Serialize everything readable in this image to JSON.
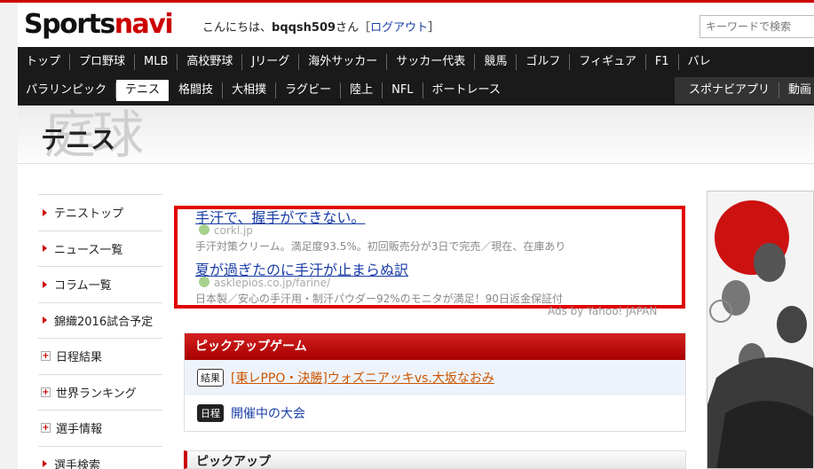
{
  "header": {
    "logo_part1": "Sports",
    "logo_part2": "navi",
    "greeting_prefix": "こんにちは、",
    "username": "bqqsh509",
    "greeting_suffix": "さん［",
    "logout": "ログアウト",
    "bracket_close": "］",
    "search_placeholder": "キーワードで検索"
  },
  "nav": {
    "row1": [
      "トップ",
      "プロ野球",
      "MLB",
      "高校野球",
      "Jリーグ",
      "海外サッカー",
      "サッカー代表",
      "競馬",
      "ゴルフ",
      "フィギュア",
      "F1",
      "バレ"
    ],
    "row2": [
      "パラリンピック",
      "テニス",
      "格闘技",
      "大相撲",
      "ラグビー",
      "陸上",
      "NFL",
      "ボートレース"
    ],
    "row2_right": [
      "スポナビアプリ",
      "動画"
    ]
  },
  "page": {
    "title": "テニス",
    "title_kanji": "庭球"
  },
  "sidebar": {
    "items": [
      {
        "label": "テニストップ"
      },
      {
        "label": "ニュース一覧"
      },
      {
        "label": "コラム一覧"
      },
      {
        "label": "錦織2016試合予定"
      },
      {
        "label": "日程結果"
      },
      {
        "label": "世界ランキング"
      },
      {
        "label": "選手情報"
      },
      {
        "label": "選手検索"
      }
    ]
  },
  "ads": {
    "items": [
      {
        "title": "手汗で、握手ができない。",
        "url": "corkl.jp",
        "desc": "手汗対策クリーム。満足度93.5%。初回販売分が3日で完売／現在、在庫あり"
      },
      {
        "title": "夏が過ぎたのに手汗が止まらぬ訳",
        "url": "asklepios.co.jp/farine/",
        "desc": "日本製／安心の手汗用・制汗パウダー92%のモニタが満足！90日返金保証付"
      }
    ],
    "ads_by": "Ads by Yahoo! JAPAN"
  },
  "pickup_game": {
    "header": "ピックアップゲーム",
    "result_tag": "結果",
    "result_link": "[東レPPO・決勝]ウォズニアッキvs.大坂なおみ",
    "schedule_tag": "日程",
    "schedule_link": "開催中の大会"
  },
  "pickup": {
    "header": "ピックアップ"
  },
  "colors": {
    "brand_red": "#cc0000",
    "nav_bg": "#1a1a1a",
    "link_blue": "#1a3ea6",
    "link_orange": "#cc5500"
  }
}
